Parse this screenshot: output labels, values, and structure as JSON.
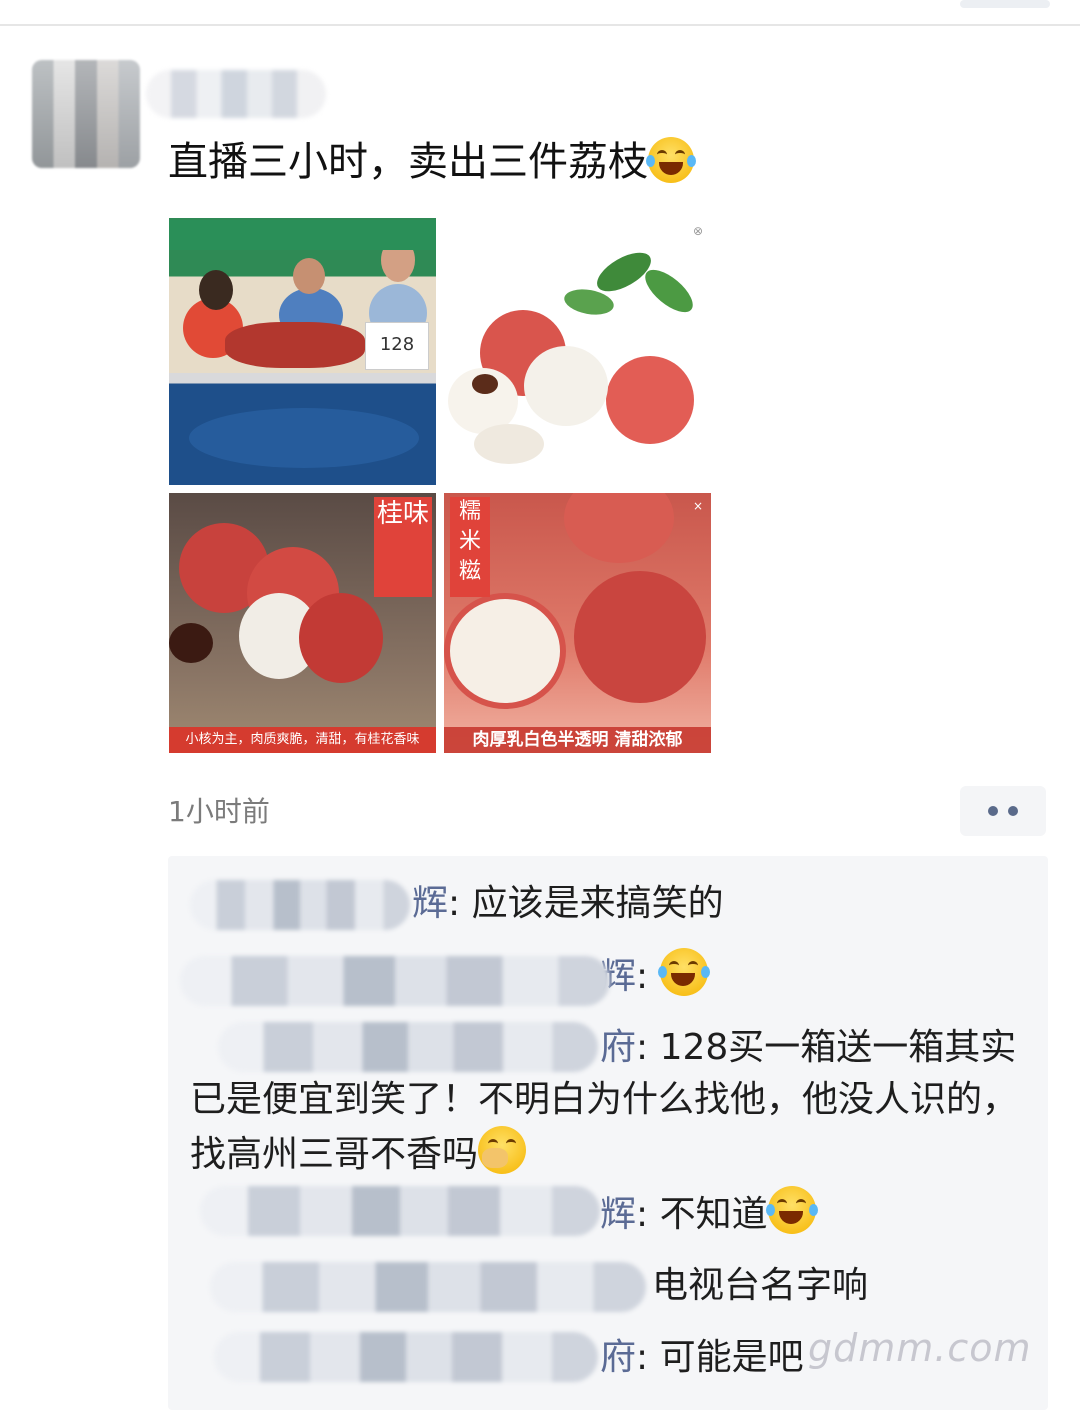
{
  "post": {
    "text": "直播三小时，卖出三件荔枝",
    "emoji": "laughing-tears-emoji",
    "timestamp": "1小时前"
  },
  "photos": [
    {
      "banner": ""
    },
    {
      "banner": ""
    },
    {
      "label": "桂味",
      "banner": "小核为主，肉质爽脆，清甜，有桂花香味"
    },
    {
      "label": "糯米糍",
      "banner": "肉厚乳白色半透明 清甜浓郁"
    }
  ],
  "photo1": {
    "price_sign": "128"
  },
  "comments": [
    {
      "name_tail": "辉",
      "text": "应该是来搞笑的",
      "emoji": ""
    },
    {
      "name_tail": "辉",
      "text": "",
      "emoji": "laughing-tears-emoji"
    },
    {
      "name_tail": "府",
      "text": "128买一箱送一箱其实已是便宜到笑了！不明白为什么找他，他没人识的，找高州三哥不香吗",
      "emoji": "face-palm-emoji"
    },
    {
      "name_tail": "辉",
      "text": "不知道",
      "emoji": "laughing-tears-emoji"
    },
    {
      "name_tail": "",
      "text": "电视台名字响",
      "emoji": ""
    },
    {
      "name_tail": "府",
      "text": "可能是吧",
      "emoji": ""
    }
  ],
  "watermark": "gdmm.com",
  "colors": {
    "link_name": "#5b6b95",
    "comment_bg": "#f5f6f8",
    "banner_red": "#d53b2f"
  }
}
